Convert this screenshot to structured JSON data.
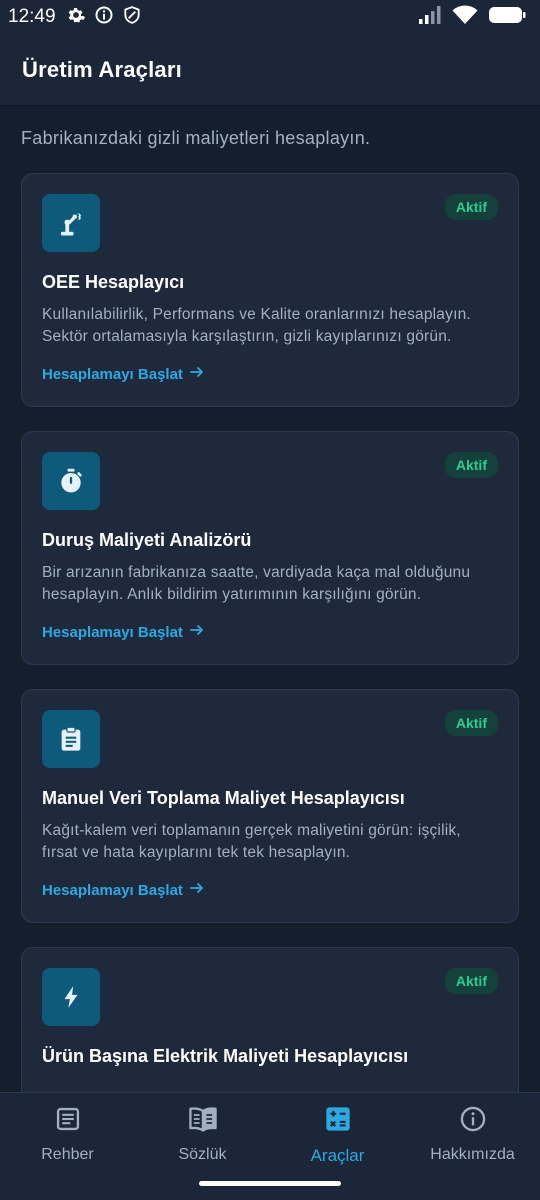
{
  "status_bar": {
    "time": "12:49",
    "left_icons": [
      "gear-icon",
      "info-icon",
      "shield-icon"
    ],
    "right_icons": [
      "signal-icon",
      "wifi-icon",
      "battery-icon"
    ]
  },
  "app_bar": {
    "title": "Üretim Araçları"
  },
  "subtitle": "Fabrikanızdaki gizli maliyetleri hesaplayın.",
  "cards": [
    {
      "icon": "robot-arm-icon",
      "badge": "Aktif",
      "title": "OEE Hesaplayıcı",
      "description": "Kullanılabilirlik, Performans ve Kalite oranlarınızı hesaplayın. Sektör ortalamasıyla karşılaştırın, gizli kayıplarınızı görün.",
      "link": "Hesaplamayı Başlat"
    },
    {
      "icon": "stopwatch-icon",
      "badge": "Aktif",
      "title": "Duruş Maliyeti Analizörü",
      "description": "Bir arızanın fabrikanıza saatte, vardiyada kaça mal olduğunu hesaplayın. Anlık bildirim yatırımının karşılığını görün.",
      "link": "Hesaplamayı Başlat"
    },
    {
      "icon": "clipboard-icon",
      "badge": "Aktif",
      "title": "Manuel Veri Toplama Maliyet Hesaplayıcısı",
      "description": "Kağıt-kalem veri toplamanın gerçek maliyetini görün: işçilik, fırsat ve hata kayıplarını tek tek hesaplayın.",
      "link": "Hesaplamayı Başlat"
    },
    {
      "icon": "lightning-icon",
      "badge": "Aktif",
      "title": "Ürün Başına Elektrik Maliyeti Hesaplayıcısı",
      "description": "",
      "link": ""
    }
  ],
  "bottom_nav": {
    "items": [
      {
        "label": "Rehber",
        "icon": "article-icon"
      },
      {
        "label": "Sözlük",
        "icon": "book-icon"
      },
      {
        "label": "Araçlar",
        "icon": "calculator-icon"
      },
      {
        "label": "Hakkımızda",
        "icon": "info-icon"
      }
    ],
    "active_index": 2
  },
  "colors": {
    "background": "#141f2e",
    "surface": "#1e2a3c",
    "accent": "#2ea8e0",
    "badge_text": "#2ecc8f",
    "icon_tile": "#0d5a7d"
  }
}
